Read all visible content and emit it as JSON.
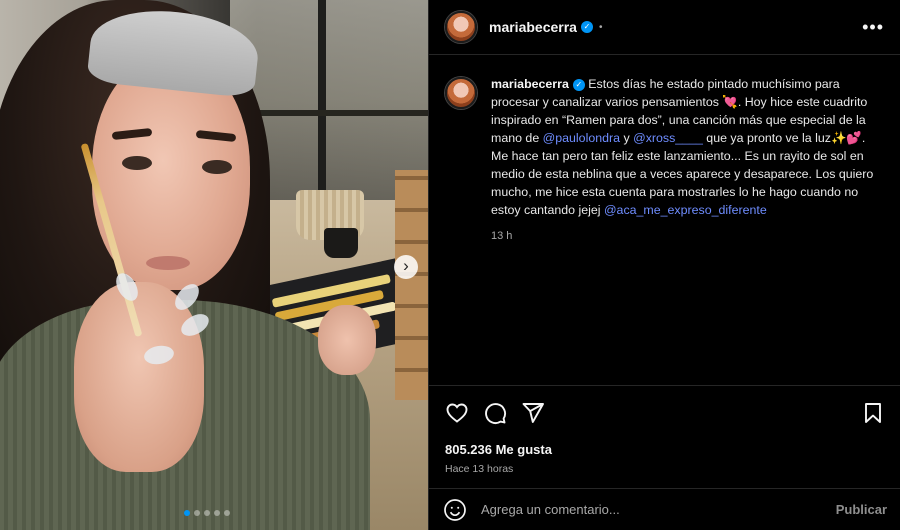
{
  "header": {
    "username": "mariabecerra",
    "verified_icon": "verified-badge-icon",
    "more_icon": "more-options-icon"
  },
  "caption": {
    "username": "mariabecerra",
    "parts": {
      "p1": "Estos días he estado pintado muchísimo para procesar y canalizar varios pensamientos 💘. Hoy hice este cuadrito inspirado en “Ramen para dos”, una canción más que especial de la mano de ",
      "mention1": "@paulolondra",
      "p2": " y ",
      "mention2": "@xross____",
      "p3": " que ya pronto ve la luz✨💕. Me hace tan pero tan feliz este lanzamiento... Es un rayito de sol en medio de esta neblina que a veces aparece y desaparece. Los quiero mucho, me hice esta cuenta para mostrarles lo he hago cuando no estoy cantando jejej ",
      "mention3": "@aca_me_expreso_diferente"
    },
    "timestamp": "13 h"
  },
  "actions": {
    "icons": [
      "heart-icon",
      "comment-icon",
      "share-icon",
      "bookmark-icon"
    ],
    "likes": "805.236 Me gusta",
    "posted": "Hace 13 horas"
  },
  "comment_box": {
    "placeholder": "Agrega un comentario...",
    "publish_label": "Publicar"
  },
  "carousel": {
    "next_icon": "chevron-right-icon",
    "slide_count": 5,
    "active_index": 0
  },
  "colors": {
    "accent": "#0095f6",
    "mention": "#6f8dff",
    "background": "#000000"
  }
}
